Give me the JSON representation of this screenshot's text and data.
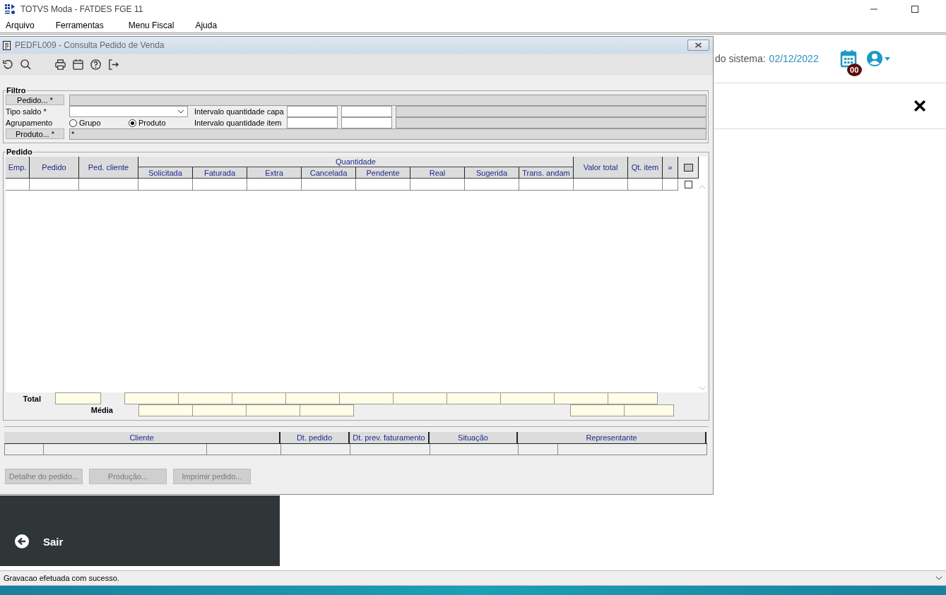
{
  "app": {
    "title": "TOTVS Moda - FATDES FGE 11"
  },
  "menu": [
    "Arquivo",
    "Ferramentas",
    "Menu Fiscal",
    "Ajuda"
  ],
  "background": {
    "system_date_label": "do sistema:",
    "system_date": "02/12/2022",
    "calendar_badge": "00",
    "exit_label": "Sair"
  },
  "window": {
    "title": "PEDFL009 - Consulta Pedido de Venda",
    "filter": {
      "legend": "Filtro",
      "pedido_button": "Pedido... *",
      "tipo_saldo_label": "Tipo saldo *",
      "capa_label": "Intervalo quantidade capa",
      "agrupamento_label": "Agrupamento",
      "item_label": "Intervalo quantidade item",
      "produto_button": "Produto... *",
      "produto_value": "*",
      "radios": [
        {
          "label": "Grupo",
          "selected": false
        },
        {
          "label": "Produto",
          "selected": true
        }
      ]
    },
    "orders": {
      "legend": "Pedido",
      "group_header": "Quantidade",
      "columns": [
        "Emp.",
        "Pedido",
        "Ped. cliente",
        "Valor total",
        "Qt. item",
        "»"
      ],
      "quantity_columns": [
        "Solicitada",
        "Faturada",
        "Extra",
        "Cancelada",
        "Pendente",
        "Real",
        "Sugerida",
        "Trans. andam"
      ],
      "row_checked": false,
      "total_label": "Total",
      "average_label": "Média"
    },
    "details": {
      "columns": [
        "Cliente",
        "Dt. pedido",
        "Dt. prev. faturamento",
        "Situação",
        "Representante"
      ]
    },
    "buttons": [
      {
        "label": "Detalhe do pedido...",
        "disabled": true
      },
      {
        "label": "Produção...",
        "disabled": true
      },
      {
        "label": "Imprimir pedido...",
        "disabled": true
      }
    ]
  },
  "status_bar": {
    "message": "Gravacao efetuada com sucesso."
  }
}
